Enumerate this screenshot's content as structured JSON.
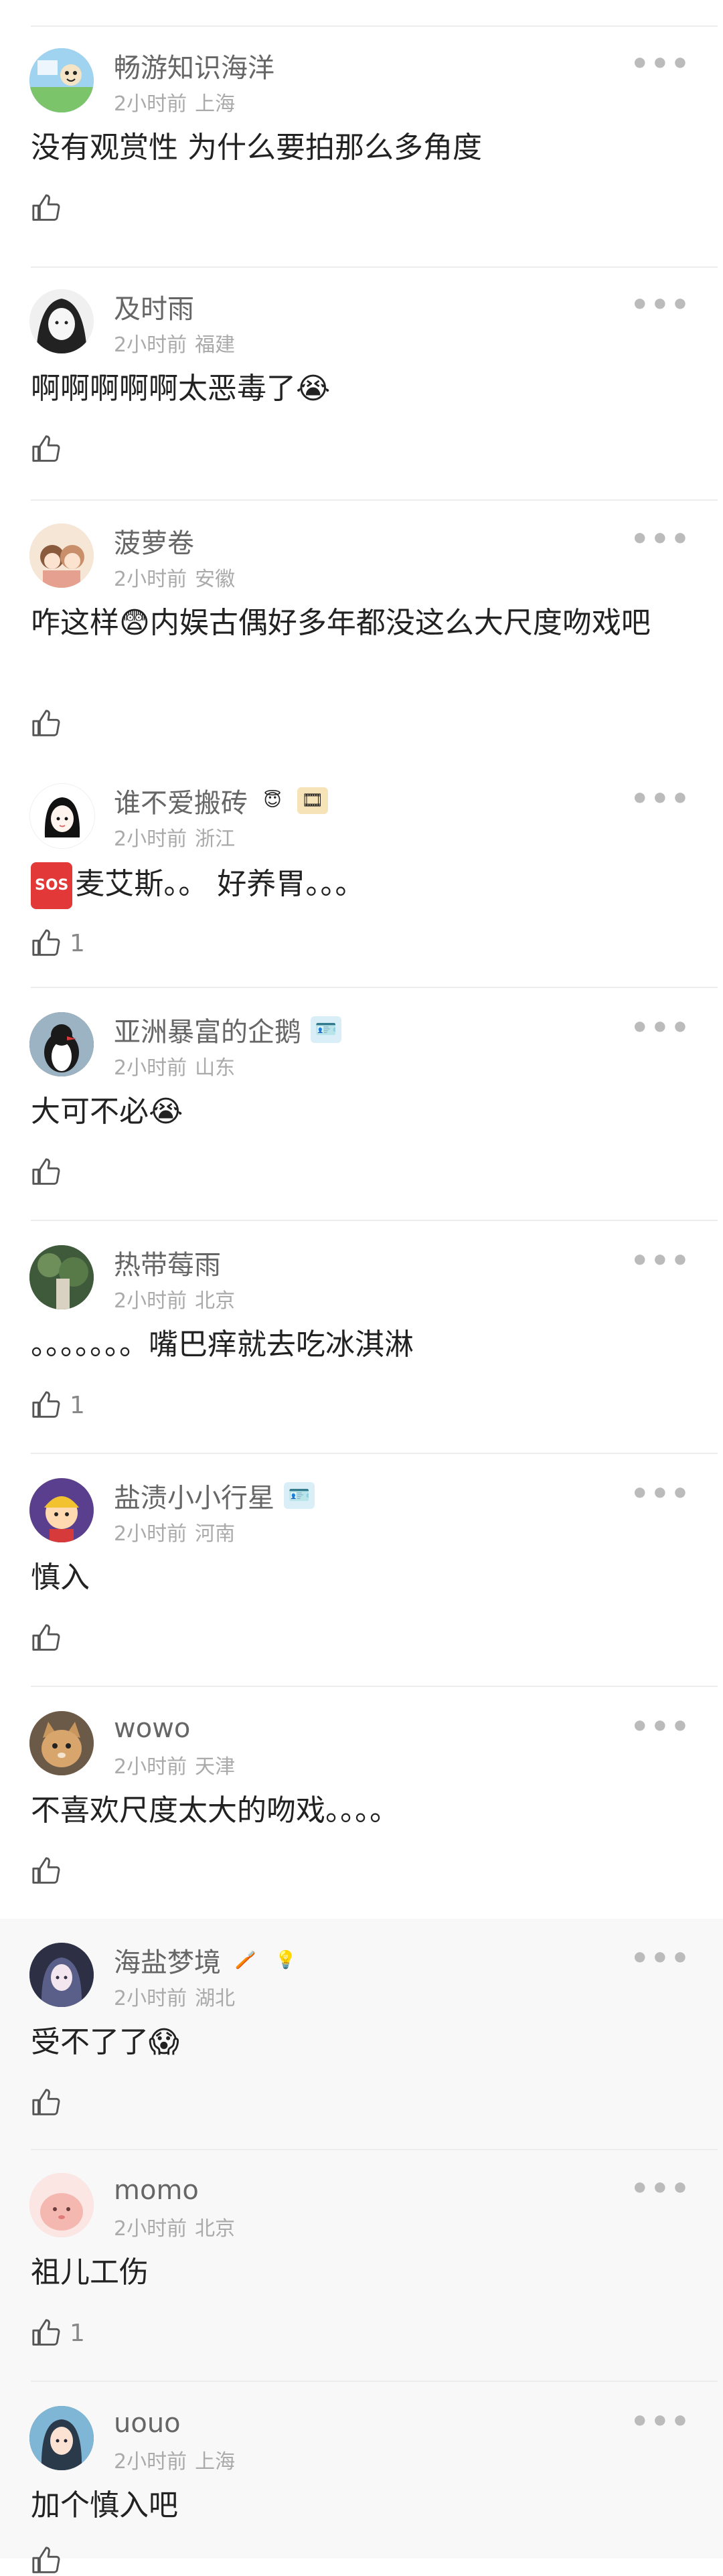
{
  "comments": [
    {
      "username": "畅游知识海洋",
      "time": "2小时前",
      "location": "上海",
      "text": "没有观赏性 为什么要拍那么多角度",
      "emoji": "",
      "likes": "",
      "avatar_color": "#6fb1d8",
      "avatar_icon": "cartoon-map-avatar"
    },
    {
      "username": "及时雨",
      "time": "2小时前",
      "location": "福建",
      "text": "啊啊啊啊啊太恶毒了",
      "emoji": "😭",
      "likes": "",
      "avatar_color": "#444444",
      "avatar_icon": "sketch-girl-avatar"
    },
    {
      "username": "菠萝卷",
      "time": "2小时前",
      "location": "安徽",
      "text": "咋这样",
      "emoji": "😨",
      "text2": "内娱古偶好多年都没这么大尺度吻戏吧",
      "likes": "",
      "avatar_color": "#d9a78a",
      "avatar_icon": "cartoon-couple-avatar"
    },
    {
      "username": "谁不爱搬砖",
      "time": "2小时前",
      "location": "浙江",
      "badge": "😇",
      "badge2": "🎞",
      "sos": "SOS",
      "text": "麦艾斯。。 好养胃。。。",
      "likes": "1",
      "avatar_color": "#ffffff",
      "avatar_icon": "cartoon-girl-avatar"
    },
    {
      "username": "亚洲暴富的企鹅",
      "time": "2小时前",
      "location": "山东",
      "badge": "🪪",
      "text": "大可不必",
      "emoji": "😭",
      "likes": "",
      "avatar_color": "#3e4a52",
      "avatar_icon": "penguin-avatar"
    },
    {
      "username": "热带莓雨",
      "time": "2小时前",
      "location": "北京",
      "text": "。。。。。。。嘴巴痒就去吃冰淇淋",
      "emoji": "",
      "likes": "1",
      "avatar_color": "#4f6f4a",
      "avatar_icon": "plant-avatar"
    },
    {
      "username": "盐渍小小行星",
      "time": "2小时前",
      "location": "河南",
      "badge": "🪪",
      "text": "慎入",
      "emoji": "",
      "likes": "",
      "avatar_color": "#d4b04a",
      "avatar_icon": "cartoon-boy-avatar"
    },
    {
      "username": "wowo",
      "time": "2小时前",
      "location": "天津",
      "text": "不喜欢尺度太大的吻戏。。。。",
      "emoji": "",
      "likes": "",
      "avatar_color": "#b48a5e",
      "avatar_icon": "cat-avatar"
    },
    {
      "username": "海盐梦境",
      "time": "2小时前",
      "location": "湖北",
      "badge": "🪥",
      "badge2": "💡",
      "text": "受不了了",
      "emoji": "😱",
      "likes": "",
      "avatar_color": "#6b6b82",
      "avatar_icon": "anime-girl-avatar"
    },
    {
      "username": "momo",
      "time": "2小时前",
      "location": "北京",
      "text": "祖儿工伤",
      "emoji": "",
      "likes": "1",
      "avatar_color": "#f2b7b0",
      "avatar_icon": "pink-blob-avatar"
    },
    {
      "username": "uouo",
      "time": "2小时前",
      "location": "上海",
      "text": "加个慎入吧",
      "emoji": "",
      "likes": "",
      "avatar_color": "#3d5f7a",
      "avatar_icon": "girl-portrait-avatar"
    }
  ],
  "colors": {
    "text": "#222222",
    "meta": "#aaaaaa",
    "username": "#666666",
    "divider": "#ececec"
  },
  "icons": {
    "like": "thumb-up-icon",
    "more": "more-dots-icon"
  }
}
